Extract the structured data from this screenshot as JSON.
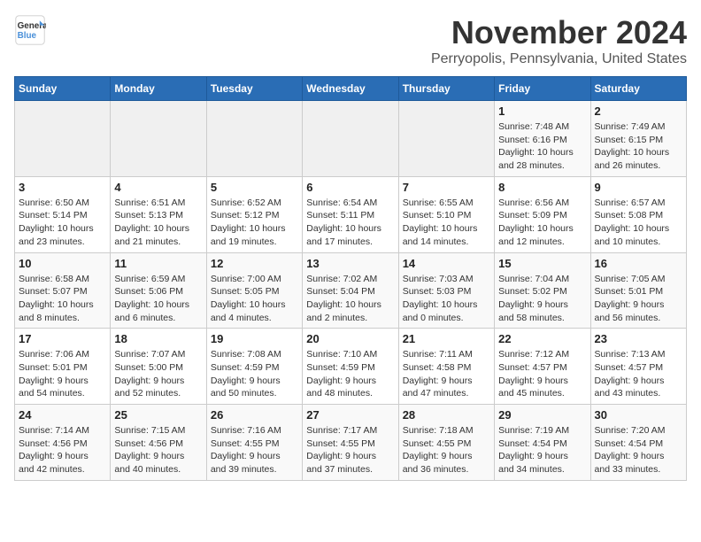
{
  "logo": {
    "line1": "General",
    "line2": "Blue"
  },
  "title": "November 2024",
  "location": "Perryopolis, Pennsylvania, United States",
  "weekdays": [
    "Sunday",
    "Monday",
    "Tuesday",
    "Wednesday",
    "Thursday",
    "Friday",
    "Saturday"
  ],
  "weeks": [
    [
      {
        "day": "",
        "detail": ""
      },
      {
        "day": "",
        "detail": ""
      },
      {
        "day": "",
        "detail": ""
      },
      {
        "day": "",
        "detail": ""
      },
      {
        "day": "",
        "detail": ""
      },
      {
        "day": "1",
        "detail": "Sunrise: 7:48 AM\nSunset: 6:16 PM\nDaylight: 10 hours\nand 28 minutes."
      },
      {
        "day": "2",
        "detail": "Sunrise: 7:49 AM\nSunset: 6:15 PM\nDaylight: 10 hours\nand 26 minutes."
      }
    ],
    [
      {
        "day": "3",
        "detail": "Sunrise: 6:50 AM\nSunset: 5:14 PM\nDaylight: 10 hours\nand 23 minutes."
      },
      {
        "day": "4",
        "detail": "Sunrise: 6:51 AM\nSunset: 5:13 PM\nDaylight: 10 hours\nand 21 minutes."
      },
      {
        "day": "5",
        "detail": "Sunrise: 6:52 AM\nSunset: 5:12 PM\nDaylight: 10 hours\nand 19 minutes."
      },
      {
        "day": "6",
        "detail": "Sunrise: 6:54 AM\nSunset: 5:11 PM\nDaylight: 10 hours\nand 17 minutes."
      },
      {
        "day": "7",
        "detail": "Sunrise: 6:55 AM\nSunset: 5:10 PM\nDaylight: 10 hours\nand 14 minutes."
      },
      {
        "day": "8",
        "detail": "Sunrise: 6:56 AM\nSunset: 5:09 PM\nDaylight: 10 hours\nand 12 minutes."
      },
      {
        "day": "9",
        "detail": "Sunrise: 6:57 AM\nSunset: 5:08 PM\nDaylight: 10 hours\nand 10 minutes."
      }
    ],
    [
      {
        "day": "10",
        "detail": "Sunrise: 6:58 AM\nSunset: 5:07 PM\nDaylight: 10 hours\nand 8 minutes."
      },
      {
        "day": "11",
        "detail": "Sunrise: 6:59 AM\nSunset: 5:06 PM\nDaylight: 10 hours\nand 6 minutes."
      },
      {
        "day": "12",
        "detail": "Sunrise: 7:00 AM\nSunset: 5:05 PM\nDaylight: 10 hours\nand 4 minutes."
      },
      {
        "day": "13",
        "detail": "Sunrise: 7:02 AM\nSunset: 5:04 PM\nDaylight: 10 hours\nand 2 minutes."
      },
      {
        "day": "14",
        "detail": "Sunrise: 7:03 AM\nSunset: 5:03 PM\nDaylight: 10 hours\nand 0 minutes."
      },
      {
        "day": "15",
        "detail": "Sunrise: 7:04 AM\nSunset: 5:02 PM\nDaylight: 9 hours\nand 58 minutes."
      },
      {
        "day": "16",
        "detail": "Sunrise: 7:05 AM\nSunset: 5:01 PM\nDaylight: 9 hours\nand 56 minutes."
      }
    ],
    [
      {
        "day": "17",
        "detail": "Sunrise: 7:06 AM\nSunset: 5:01 PM\nDaylight: 9 hours\nand 54 minutes."
      },
      {
        "day": "18",
        "detail": "Sunrise: 7:07 AM\nSunset: 5:00 PM\nDaylight: 9 hours\nand 52 minutes."
      },
      {
        "day": "19",
        "detail": "Sunrise: 7:08 AM\nSunset: 4:59 PM\nDaylight: 9 hours\nand 50 minutes."
      },
      {
        "day": "20",
        "detail": "Sunrise: 7:10 AM\nSunset: 4:59 PM\nDaylight: 9 hours\nand 48 minutes."
      },
      {
        "day": "21",
        "detail": "Sunrise: 7:11 AM\nSunset: 4:58 PM\nDaylight: 9 hours\nand 47 minutes."
      },
      {
        "day": "22",
        "detail": "Sunrise: 7:12 AM\nSunset: 4:57 PM\nDaylight: 9 hours\nand 45 minutes."
      },
      {
        "day": "23",
        "detail": "Sunrise: 7:13 AM\nSunset: 4:57 PM\nDaylight: 9 hours\nand 43 minutes."
      }
    ],
    [
      {
        "day": "24",
        "detail": "Sunrise: 7:14 AM\nSunset: 4:56 PM\nDaylight: 9 hours\nand 42 minutes."
      },
      {
        "day": "25",
        "detail": "Sunrise: 7:15 AM\nSunset: 4:56 PM\nDaylight: 9 hours\nand 40 minutes."
      },
      {
        "day": "26",
        "detail": "Sunrise: 7:16 AM\nSunset: 4:55 PM\nDaylight: 9 hours\nand 39 minutes."
      },
      {
        "day": "27",
        "detail": "Sunrise: 7:17 AM\nSunset: 4:55 PM\nDaylight: 9 hours\nand 37 minutes."
      },
      {
        "day": "28",
        "detail": "Sunrise: 7:18 AM\nSunset: 4:55 PM\nDaylight: 9 hours\nand 36 minutes."
      },
      {
        "day": "29",
        "detail": "Sunrise: 7:19 AM\nSunset: 4:54 PM\nDaylight: 9 hours\nand 34 minutes."
      },
      {
        "day": "30",
        "detail": "Sunrise: 7:20 AM\nSunset: 4:54 PM\nDaylight: 9 hours\nand 33 minutes."
      }
    ]
  ]
}
